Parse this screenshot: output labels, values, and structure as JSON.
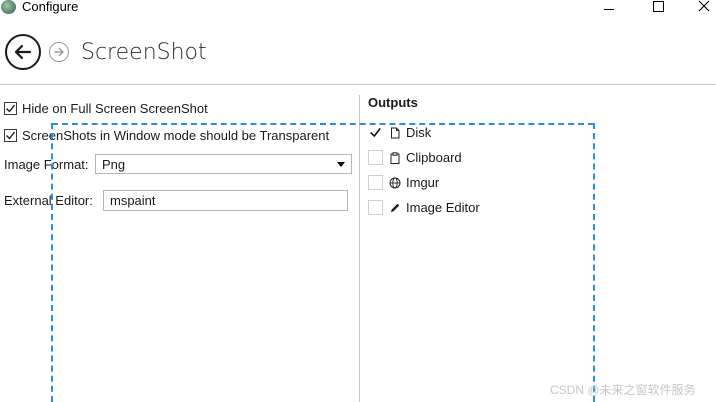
{
  "window": {
    "title": "Configure",
    "icons": [
      "app-icon",
      "minimize-icon",
      "maximize-icon",
      "close-icon"
    ]
  },
  "header": {
    "title": "ScreenShot",
    "back_icon": "arrow-left-icon",
    "forward_icon": "arrow-right-icon"
  },
  "settings": {
    "hide_fullscreen": {
      "label": "Hide on Full Screen ScreenShot",
      "checked": true
    },
    "transparent_window": {
      "label": "ScreenShots in Window mode should be Transparent",
      "checked": true
    },
    "image_format": {
      "label": "Image Format:",
      "value": "Png"
    },
    "external_editor": {
      "label": "External Editor:",
      "value": "mspaint"
    }
  },
  "outputs": {
    "title": "Outputs",
    "items": [
      {
        "label": "Disk",
        "icon": "file-icon",
        "checked": true
      },
      {
        "label": "Clipboard",
        "icon": "clipboard-icon",
        "checked": false
      },
      {
        "label": "Imgur",
        "icon": "globe-icon",
        "checked": false
      },
      {
        "label": "Image Editor",
        "icon": "pencil-icon",
        "checked": false
      }
    ]
  },
  "overlay": {
    "color": "#2a8fd8"
  },
  "watermark": "CSDN @未来之窗软件服务"
}
